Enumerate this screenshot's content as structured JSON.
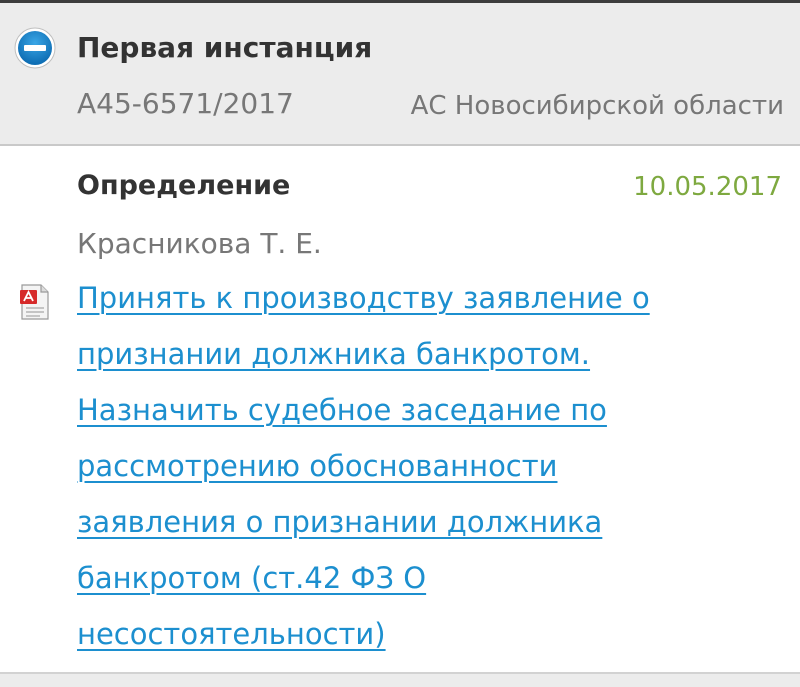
{
  "instance": {
    "title": "Первая инстанция",
    "case_number": "А45-6571/2017",
    "court": "АС Новосибирской области",
    "toggle_icon": "minus-circle-icon"
  },
  "document": {
    "type": "Определение",
    "date": "10.05.2017",
    "judge": "Красникова Т. Е.",
    "file_icon": "pdf-file-icon",
    "link_lines": [
      "Принять к производству заявление о",
      "признании должника банкротом.",
      "Назначить судебное заседание по",
      "рассмотрению обоснованности",
      "заявления о признании должника",
      "банкротом (ст.42 ФЗ О",
      "несостоятельности)"
    ]
  },
  "colors": {
    "accent_blue": "#1c8fcf",
    "date_green": "#7ea940",
    "header_bg": "#ececec"
  }
}
